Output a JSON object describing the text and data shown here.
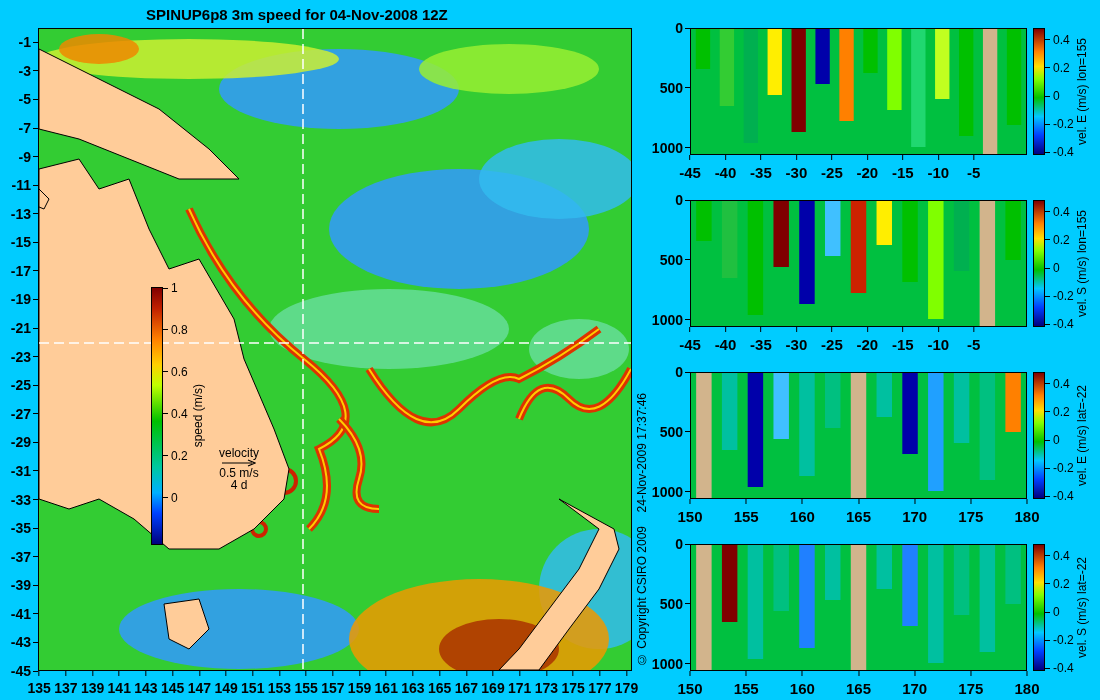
{
  "title": "SPINUP6p8 3m speed for 04-Nov-2008 12Z",
  "map": {
    "yticks": [
      "-1",
      "-3",
      "-5",
      "-7",
      "-9",
      "-11",
      "-13",
      "-15",
      "-17",
      "-19",
      "-21",
      "-23",
      "-25",
      "-27",
      "-29",
      "-31",
      "-33",
      "-35",
      "-37",
      "-39",
      "-41",
      "-43",
      "-45"
    ],
    "xticks": [
      "135",
      "137",
      "139",
      "141",
      "143",
      "145",
      "147",
      "149",
      "151",
      "153",
      "155",
      "157",
      "159",
      "161",
      "163",
      "165",
      "167",
      "169",
      "171",
      "173",
      "175",
      "177",
      "179"
    ],
    "colorbar": {
      "label": "speed (m/s)",
      "ticks": [
        "1",
        "0.8",
        "0.6",
        "0.4",
        "0.2",
        "0"
      ]
    },
    "legend": {
      "title": "velocity",
      "speed": "0.5 m/s",
      "duration": "4 d"
    }
  },
  "copyright": [
    "© Copyright CSIRO 2009",
    "24-Nov-2009 17:37:46"
  ],
  "sections": [
    {
      "yticks": [
        "0",
        "500",
        "1000"
      ],
      "xticks": [
        "-45",
        "-40",
        "-35",
        "-30",
        "-25",
        "-20",
        "-15",
        "-10",
        "-5"
      ],
      "colorbar": {
        "label": "vel. E (m/s) lon=155",
        "ticks": [
          "0.4",
          "0.2",
          "0",
          "-0.2",
          "-0.4"
        ]
      }
    },
    {
      "yticks": [
        "0",
        "500",
        "1000"
      ],
      "xticks": [
        "-45",
        "-40",
        "-35",
        "-30",
        "-25",
        "-20",
        "-15",
        "-10",
        "-5"
      ],
      "colorbar": {
        "label": "vel. S (m/s) lon=155",
        "ticks": [
          "0.4",
          "0.2",
          "0",
          "-0.2",
          "-0.4"
        ]
      }
    },
    {
      "yticks": [
        "0",
        "500",
        "1000"
      ],
      "xticks": [
        "150",
        "155",
        "160",
        "165",
        "170",
        "175",
        "180"
      ],
      "colorbar": {
        "label": "vel. E (m/s) lat=-22",
        "ticks": [
          "0.4",
          "0.2",
          "0",
          "-0.2",
          "-0.4"
        ]
      }
    },
    {
      "yticks": [
        "0",
        "500",
        "1000"
      ],
      "xticks": [
        "150",
        "155",
        "160",
        "165",
        "170",
        "175",
        "180"
      ],
      "colorbar": {
        "label": "vel. S (m/s) lat=-22",
        "ticks": [
          "0.4",
          "0.2",
          "0",
          "-0.2",
          "-0.4"
        ]
      }
    }
  ]
}
